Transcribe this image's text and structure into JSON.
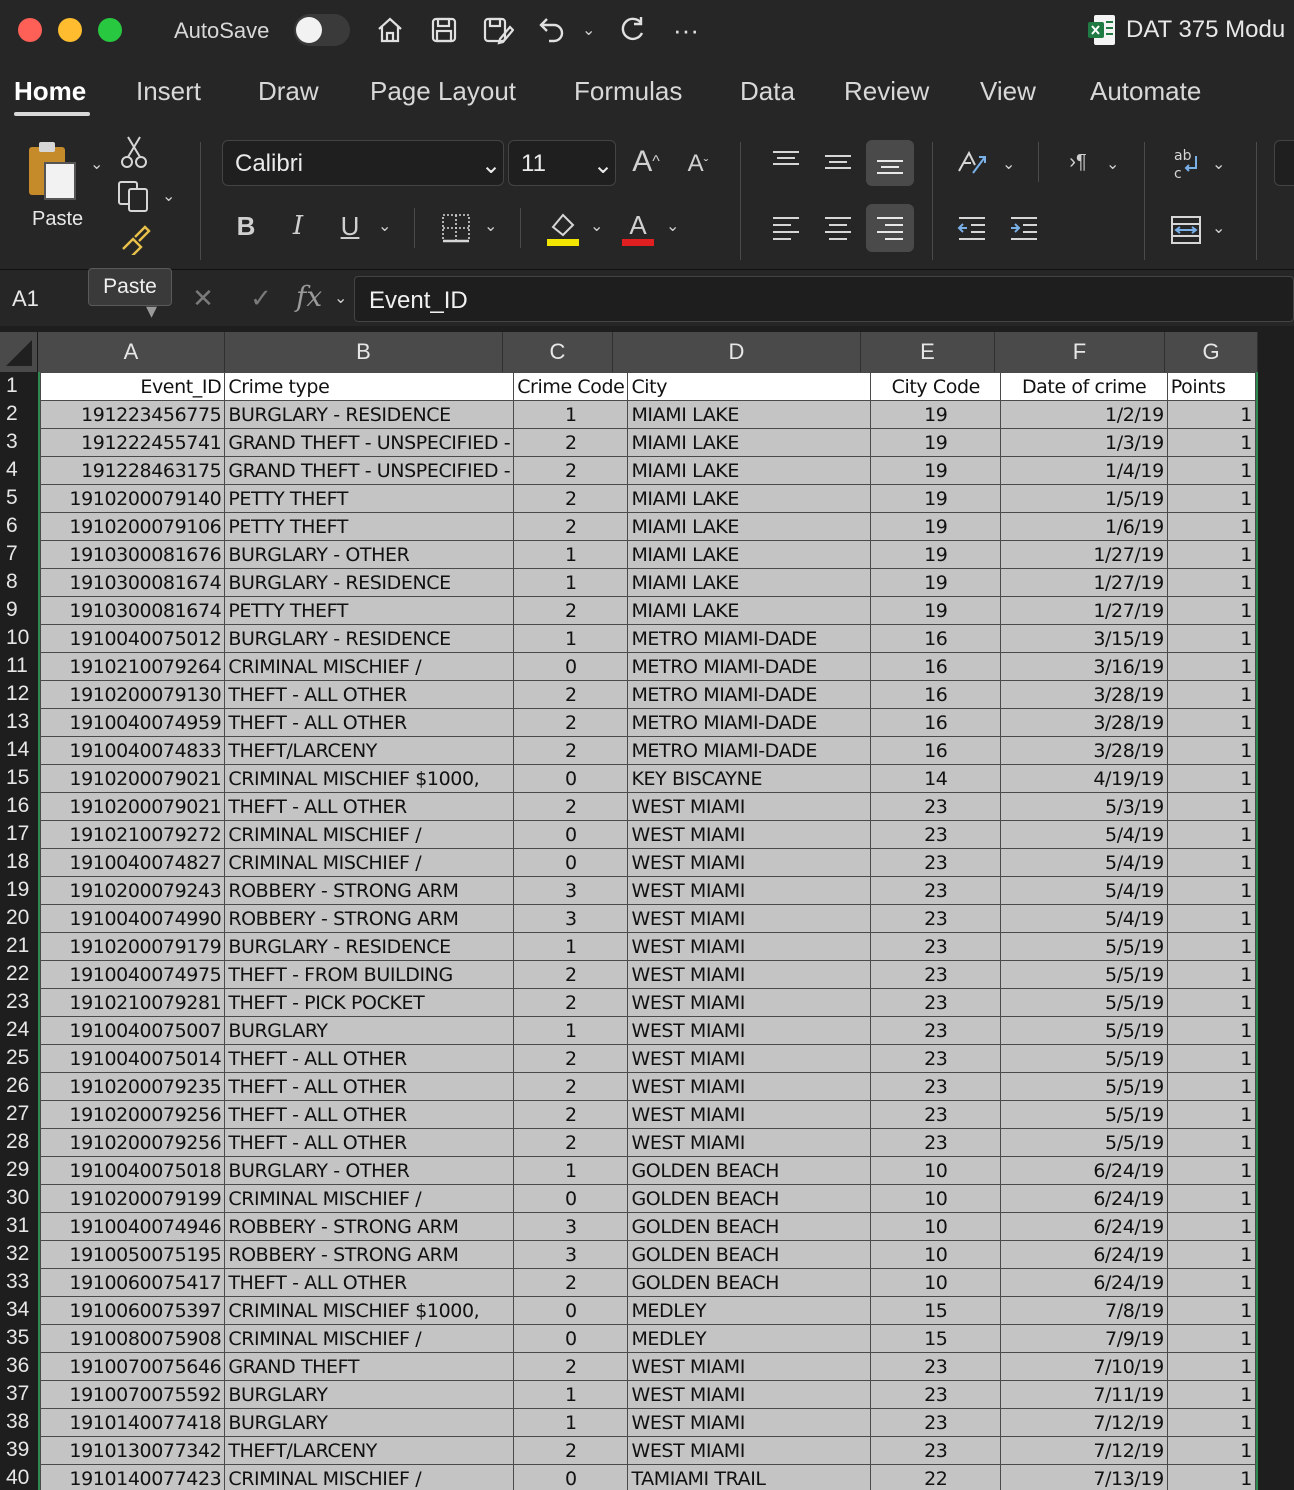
{
  "titlebar": {
    "autosave_label": "AutoSave",
    "document_title": "DAT 375 Modu"
  },
  "tabs": [
    {
      "label": "Home"
    },
    {
      "label": "Insert"
    },
    {
      "label": "Draw"
    },
    {
      "label": "Page Layout"
    },
    {
      "label": "Formulas"
    },
    {
      "label": "Data"
    },
    {
      "label": "Review"
    },
    {
      "label": "View"
    },
    {
      "label": "Automate"
    }
  ],
  "ribbon": {
    "paste_label": "Paste",
    "font_name": "Calibri",
    "font_size": "11",
    "bold_label": "B",
    "italic_label": "I",
    "underline_label": "U",
    "font_color_label": "A",
    "increase_font": "A",
    "decrease_font": "A",
    "colors": {
      "highlight": "#f2e600",
      "font_color": "#e02020"
    }
  },
  "formula_bar": {
    "name_box": "A1",
    "tooltip": "Paste",
    "fx": "fx",
    "content": "Event_ID"
  },
  "columns": [
    "A",
    "B",
    "C",
    "D",
    "E",
    "F",
    "G"
  ],
  "header_row": [
    "Event_ID",
    "Crime type",
    "Crime Code",
    "City",
    "City Code",
    "Date of crime",
    "Points"
  ],
  "rows": [
    [
      "191223456775",
      "BURGLARY - RESIDENCE",
      "1",
      "MIAMI LAKE",
      "19",
      "1/2/19",
      "1"
    ],
    [
      "191222455741",
      "GRAND THEFT - UNSPECIFIED -",
      "2",
      "MIAMI LAKE",
      "19",
      "1/3/19",
      "1"
    ],
    [
      "191228463175",
      "GRAND THEFT - UNSPECIFIED -",
      "2",
      "MIAMI LAKE",
      "19",
      "1/4/19",
      "1"
    ],
    [
      "1910200079140",
      "PETTY THEFT",
      "2",
      "MIAMI LAKE",
      "19",
      "1/5/19",
      "1"
    ],
    [
      "1910200079106",
      "PETTY THEFT",
      "2",
      "MIAMI LAKE",
      "19",
      "1/6/19",
      "1"
    ],
    [
      "1910300081676",
      "BURGLARY - OTHER",
      "1",
      "MIAMI LAKE",
      "19",
      "1/27/19",
      "1"
    ],
    [
      "1910300081674",
      "BURGLARY - RESIDENCE",
      "1",
      "MIAMI LAKE",
      "19",
      "1/27/19",
      "1"
    ],
    [
      "1910300081674",
      "PETTY THEFT",
      "2",
      "MIAMI LAKE",
      "19",
      "1/27/19",
      "1"
    ],
    [
      "1910040075012",
      "BURGLARY - RESIDENCE",
      "1",
      "METRO MIAMI-DADE",
      "16",
      "3/15/19",
      "1"
    ],
    [
      "1910210079264",
      "CRIMINAL MISCHIEF /",
      "0",
      "METRO MIAMI-DADE",
      "16",
      "3/16/19",
      "1"
    ],
    [
      "1910200079130",
      "THEFT - ALL OTHER",
      "2",
      "METRO MIAMI-DADE",
      "16",
      "3/28/19",
      "1"
    ],
    [
      "1910040074959",
      "THEFT - ALL OTHER",
      "2",
      "METRO MIAMI-DADE",
      "16",
      "3/28/19",
      "1"
    ],
    [
      "1910040074833",
      "THEFT/LARCENY",
      "2",
      "METRO MIAMI-DADE",
      "16",
      "3/28/19",
      "1"
    ],
    [
      "1910200079021",
      "CRIMINAL MISCHIEF $1000,",
      "0",
      "KEY BISCAYNE",
      "14",
      "4/19/19",
      "1"
    ],
    [
      "1910200079021",
      "THEFT - ALL OTHER",
      "2",
      "WEST MIAMI",
      "23",
      "5/3/19",
      "1"
    ],
    [
      "1910210079272",
      "CRIMINAL MISCHIEF /",
      "0",
      "WEST MIAMI",
      "23",
      "5/4/19",
      "1"
    ],
    [
      "1910040074827",
      "CRIMINAL MISCHIEF /",
      "0",
      "WEST MIAMI",
      "23",
      "5/4/19",
      "1"
    ],
    [
      "1910200079243",
      "ROBBERY - STRONG ARM",
      "3",
      "WEST MIAMI",
      "23",
      "5/4/19",
      "1"
    ],
    [
      "1910040074990",
      "ROBBERY - STRONG ARM",
      "3",
      "WEST MIAMI",
      "23",
      "5/4/19",
      "1"
    ],
    [
      "1910200079179",
      "BURGLARY - RESIDENCE",
      "1",
      "WEST MIAMI",
      "23",
      "5/5/19",
      "1"
    ],
    [
      "1910040074975",
      "THEFT - FROM BUILDING",
      "2",
      "WEST MIAMI",
      "23",
      "5/5/19",
      "1"
    ],
    [
      "1910210079281",
      "THEFT - PICK POCKET",
      "2",
      "WEST MIAMI",
      "23",
      "5/5/19",
      "1"
    ],
    [
      "1910040075007",
      "BURGLARY",
      "1",
      "WEST MIAMI",
      "23",
      "5/5/19",
      "1"
    ],
    [
      "1910040075014",
      "THEFT - ALL OTHER",
      "2",
      "WEST MIAMI",
      "23",
      "5/5/19",
      "1"
    ],
    [
      "1910200079235",
      "THEFT - ALL OTHER",
      "2",
      "WEST MIAMI",
      "23",
      "5/5/19",
      "1"
    ],
    [
      "1910200079256",
      "THEFT - ALL OTHER",
      "2",
      "WEST MIAMI",
      "23",
      "5/5/19",
      "1"
    ],
    [
      "1910200079256",
      "THEFT - ALL OTHER",
      "2",
      "WEST MIAMI",
      "23",
      "5/5/19",
      "1"
    ],
    [
      "1910040075018",
      "BURGLARY - OTHER",
      "1",
      "GOLDEN BEACH",
      "10",
      "6/24/19",
      "1"
    ],
    [
      "1910200079199",
      "CRIMINAL MISCHIEF /",
      "0",
      "GOLDEN BEACH",
      "10",
      "6/24/19",
      "1"
    ],
    [
      "1910040074946",
      "ROBBERY - STRONG ARM",
      "3",
      "GOLDEN BEACH",
      "10",
      "6/24/19",
      "1"
    ],
    [
      "1910050075195",
      "ROBBERY - STRONG ARM",
      "3",
      "GOLDEN BEACH",
      "10",
      "6/24/19",
      "1"
    ],
    [
      "1910060075417",
      "THEFT - ALL OTHER",
      "2",
      "GOLDEN BEACH",
      "10",
      "6/24/19",
      "1"
    ],
    [
      "1910060075397",
      "CRIMINAL MISCHIEF $1000,",
      "0",
      "MEDLEY",
      "15",
      "7/8/19",
      "1"
    ],
    [
      "1910080075908",
      "CRIMINAL MISCHIEF /",
      "0",
      "MEDLEY",
      "15",
      "7/9/19",
      "1"
    ],
    [
      "1910070075646",
      "GRAND THEFT",
      "2",
      "WEST MIAMI",
      "23",
      "7/10/19",
      "1"
    ],
    [
      "1910070075592",
      "BURGLARY",
      "1",
      "WEST MIAMI",
      "23",
      "7/11/19",
      "1"
    ],
    [
      "1910140077418",
      "BURGLARY",
      "1",
      "WEST MIAMI",
      "23",
      "7/12/19",
      "1"
    ],
    [
      "1910130077342",
      "THEFT/LARCENY",
      "2",
      "WEST MIAMI",
      "23",
      "7/12/19",
      "1"
    ],
    [
      "1910140077423",
      "CRIMINAL MISCHIEF /",
      "0",
      "TAMIAMI TRAIL",
      "22",
      "7/13/19",
      "1"
    ]
  ]
}
